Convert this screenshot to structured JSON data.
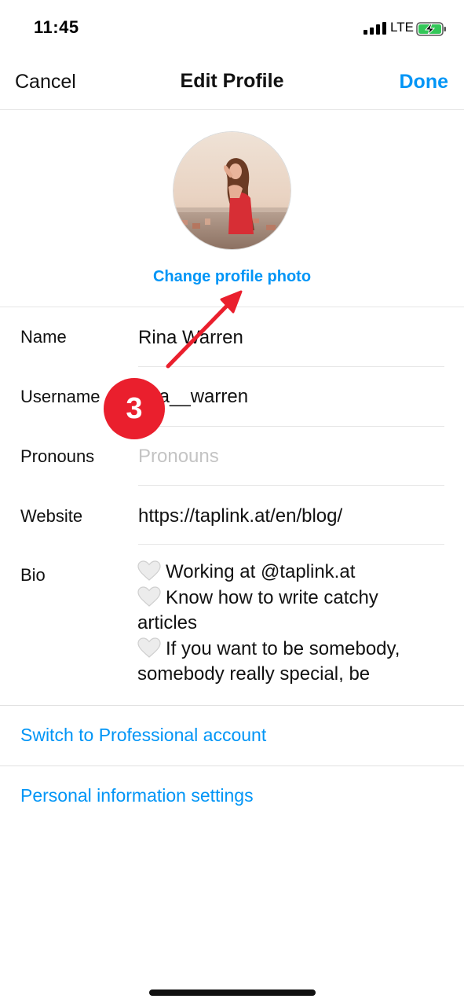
{
  "status_bar": {
    "time": "11:45",
    "network": "LTE",
    "icons": [
      "signal-icon",
      "battery-charging-icon"
    ]
  },
  "nav": {
    "cancel_label": "Cancel",
    "title": "Edit Profile",
    "done_label": "Done"
  },
  "profile": {
    "change_photo_label": "Change profile photo"
  },
  "fields": {
    "name": {
      "label": "Name",
      "value": "Rina Warren"
    },
    "username": {
      "label": "Username",
      "value": "rina__warren"
    },
    "pronouns": {
      "label": "Pronouns",
      "placeholder": "Pronouns"
    },
    "website": {
      "label": "Website",
      "value": "https://taplink.at/en/blog/"
    },
    "bio": {
      "label": "Bio",
      "lines": [
        "Working at @taplink.at",
        "Know how to write catchy",
        "articles",
        "If you want to be somebody,",
        "somebody really special, be"
      ]
    }
  },
  "links": {
    "professional": "Switch to Professional account",
    "personal_info": "Personal information settings"
  },
  "annotation": {
    "step_number": "3"
  },
  "colors": {
    "accent": "#0095f6",
    "annotation": "#ea1f2d",
    "battery": "#34c759"
  }
}
